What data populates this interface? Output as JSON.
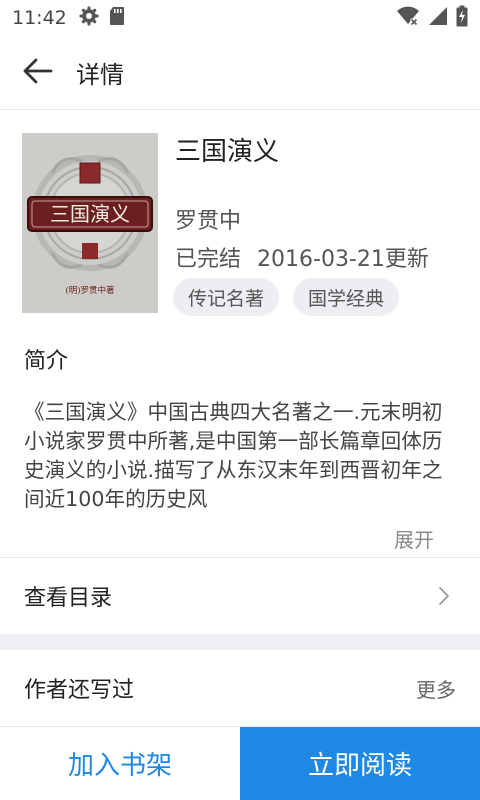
{
  "status_bar": {
    "time": "11:42",
    "icons": [
      "gear-icon",
      "sd-card-icon",
      "wifi-icon",
      "signal-icon",
      "battery-icon"
    ]
  },
  "app_bar": {
    "back_icon": "back-arrow-icon",
    "title": "详情"
  },
  "book": {
    "title": "三国演义",
    "author": "罗贯中",
    "status": "已完结",
    "updated": "2016-03-21更新",
    "tags": [
      "传记名著",
      "国学经典"
    ],
    "cover": {
      "title_text": "三国演义",
      "author_text": "(明)罗贯中著"
    }
  },
  "intro": {
    "heading": "简介",
    "text": "《三国演义》中国古典四大名著之一.元末明初小说家罗贯中所著,是中国第一部长篇章回体历史演义的小说.描写了从东汉末年到西晋初年之间近100年的历史风",
    "expand_label": "展开"
  },
  "toc": {
    "label": "查看目录",
    "icon": "chevron-right-icon"
  },
  "author_section": {
    "label": "作者还写过",
    "more_label": "更多"
  },
  "actions": {
    "shelf_label": "加入书架",
    "read_label": "立即阅读"
  },
  "colors": {
    "accent": "#1e88e5",
    "tag_bg": "#ededf2",
    "section_gap": "#f0f0f4"
  }
}
